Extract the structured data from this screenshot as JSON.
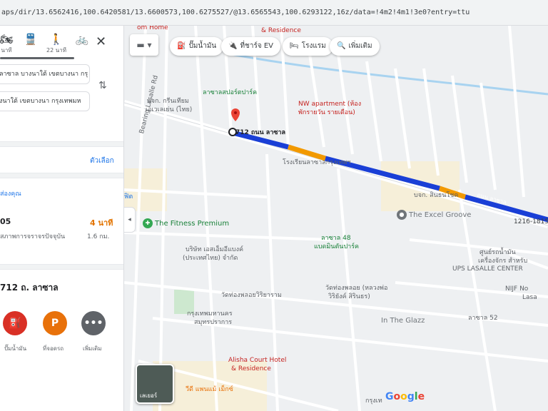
{
  "url": "aps/dir/13.6562416,100.6420581/13.6600573,100.6275527/@13.6565543,100.6293122,16z/data=!4m2!4m1!3e0?entry=ttu",
  "panel": {
    "modes": [
      {
        "icon": "motorcycle-icon",
        "glyph": "🏍",
        "time": "นาที"
      },
      {
        "icon": "transit-icon",
        "glyph": "🚆",
        "time": ""
      },
      {
        "icon": "walk-icon",
        "glyph": "🚶",
        "time": "22 นาที"
      },
      {
        "icon": "bicycle-icon",
        "glyph": "🚲",
        "time": ""
      }
    ],
    "close_glyph": "✕",
    "origin_text": "ลาซาล บางนาใต้ เขตบางนา กรุ",
    "destination_text": "งนาใต้ เขตบางนา กรุงเทพมห",
    "options_label": "ตัวเลือก",
    "section_title": "ส่องคุณ",
    "route": {
      "name": "05",
      "time": "4 นาที",
      "desc": "สภาพการจราจรปัจจุบัน",
      "distance": "1.6 กม."
    },
    "place_title": "712 ถ. ลาซาล",
    "categories": [
      {
        "label": "ปั๊มน้ำมัน",
        "glyph": "⛽",
        "color": "#d93025"
      },
      {
        "label": "ที่จอดรถ",
        "glyph": "P",
        "color": "#e8710a"
      },
      {
        "label": "เพิ่มเติม",
        "glyph": "•••",
        "color": "#5f6368"
      }
    ],
    "collapse_glyph": "◂"
  },
  "map": {
    "layers_glyph": "▬ ▾",
    "chips": [
      {
        "label": "ปั๊มน้ำมัน",
        "glyph": "⛽"
      },
      {
        "label": "ที่ชาร์จ EV",
        "glyph": "🔌"
      },
      {
        "label": "โรงแรม",
        "glyph": "🛏"
      },
      {
        "label": "เพิ่มเติม",
        "glyph": "🔍"
      }
    ],
    "labels": {
      "start_addr": "712 ถนน ลาซาล",
      "hotel_top": "& Residence",
      "hotel_top_name": "Alisha Court Hotel",
      "home": "om Home",
      "lasalle_park": "ลาซาลสปอร์ตปาร์ค",
      "company": "บจก. กรีนเทียม",
      "company2": "เอเวเลเย่น (ไทย)",
      "nw_apartment": "NW apartment (ห้อง",
      "nw_apartment2": "พักรายวัน รายเดือน)",
      "school": "โรงเรียนลาซาลกรุงเทพฯ",
      "fitness": "The Fitness Premium",
      "fitness_dup": "ฟิต",
      "excel_groove": "The Excel Groove",
      "lasalle48": "ลาซาล 48",
      "lasalle48b": "แบดมินตันปาร์ค",
      "wat": "วัดท่องพลอย (หลวงพ่อ",
      "wat2": "วิริยังค์ สิรินธร)",
      "wat_school": "วัดท่องพลอยวิริยาราม",
      "company3": "บริษัท เอสเอ็มอีแบงค์",
      "company3b": "(ประเทศไทย) จำกัด",
      "glazz": "In The Glazz",
      "ups": "UPS LASALLE CENTER",
      "nijf": "NIJF No",
      "nijf2": "Lasa",
      "building": "1216-1815",
      "shop_center": "ศูนย์รถน้ำมัน",
      "shop_center2": "เครื่องจักร สำหรับ",
      "lasalle_shop": "บจก. สินธนโชค",
      "soi52": "ลาซาล 52",
      "bangkok_district": "กรุงเทพมหานคร",
      "samut": "สมุทรปราการ",
      "alisha_bottom": "Alisha Court Hotel",
      "alisha_bottom2": "& Residence",
      "wii": "วีดี แพนแม้ เม็กซ์",
      "road_bearing": "Bearing Lasalle Rd",
      "road_lasalle": "ถนน ลาซาล",
      "thumb_label": "เลเยอร์",
      "google": "Google",
      "krung": "กรุงเท"
    }
  }
}
